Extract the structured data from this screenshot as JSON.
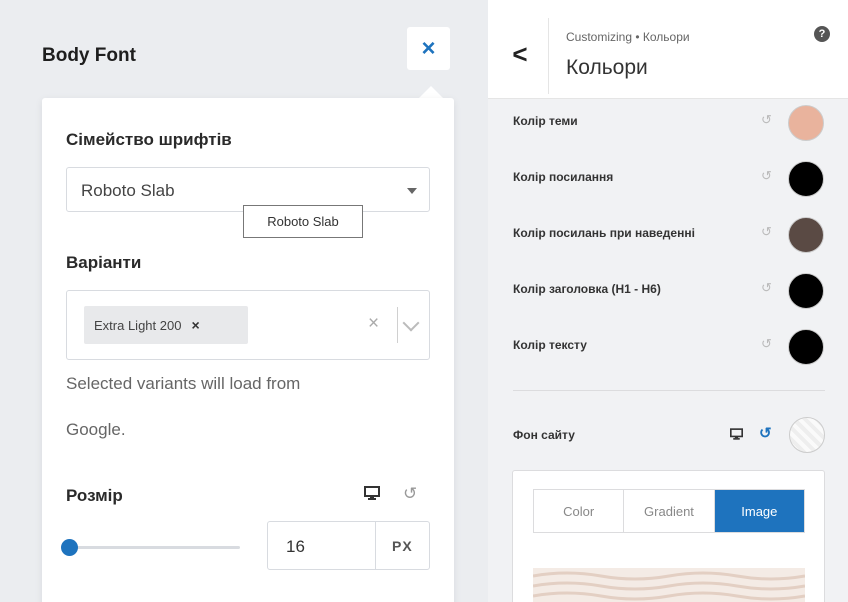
{
  "left_panel": {
    "title": "Body Font",
    "close_glyph": "×",
    "font_family": {
      "label": "Сімейство шрифтів",
      "value": "Roboto Slab",
      "tooltip": "Roboto Slab"
    },
    "variants": {
      "label": "Варіанти",
      "chip": "Extra Light 200",
      "chip_remove": "×",
      "clear": "×",
      "help_line1": "Selected variants will load from",
      "help_line2": "Google."
    },
    "size": {
      "label": "Розмір",
      "value": "16",
      "unit": "PX",
      "reset_glyph": "↺",
      "slider_fraction": 0.0
    }
  },
  "right_panel": {
    "breadcrumb": "Customizing • Кольори",
    "title": "Кольори",
    "back_glyph": "<",
    "help_glyph": "?",
    "reset_glyph": "↺",
    "colors": [
      {
        "label": "Колір теми",
        "color": "#e9b39d"
      },
      {
        "label": "Колір посилання",
        "color": "#000000"
      },
      {
        "label": "Колір посилань при наведенні",
        "color": "#5a4a44"
      },
      {
        "label": "Колір заголовка (H1 - H6)",
        "color": "#000000"
      },
      {
        "label": "Колір тексту",
        "color": "#000000"
      }
    ],
    "background": {
      "label": "Фон сайту",
      "reset_glyph": "↺",
      "tabs": [
        "Color",
        "Gradient",
        "Image"
      ],
      "active_tab": "Image"
    }
  },
  "accent_color": "#1e73be"
}
